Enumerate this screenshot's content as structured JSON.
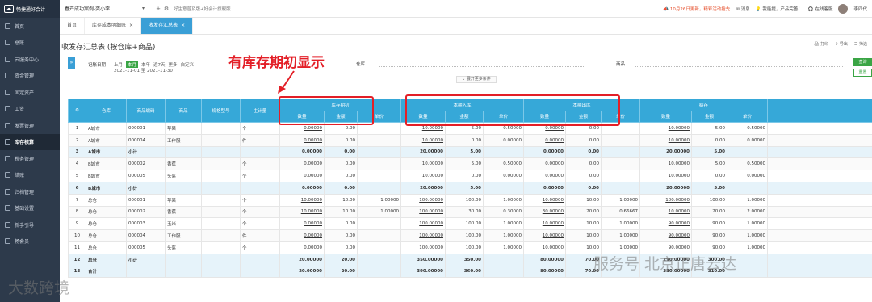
{
  "app": {
    "name": "畅捷通好会计",
    "company": "春卉成功案例-龚小李",
    "promo": "好生意普及版+好会计旗舰版"
  },
  "topbar": {
    "notice_date": "10月26日更新",
    "notice_text": "，精彩活动抢先",
    "msg_label": "消息",
    "feedback_label": "我能提，产品完善！",
    "service_label": "在线客服",
    "user_label": "李四代"
  },
  "sidebar": {
    "items": [
      {
        "label": "首页"
      },
      {
        "label": "总账"
      },
      {
        "label": "云服务中心"
      },
      {
        "label": "资金管理"
      },
      {
        "label": "固定资产"
      },
      {
        "label": "工资"
      },
      {
        "label": "发票管理"
      },
      {
        "label": "库存核算"
      },
      {
        "label": "税务管理"
      },
      {
        "label": "结账"
      },
      {
        "label": "归档管理"
      },
      {
        "label": "基础设置"
      },
      {
        "label": "新手引导"
      },
      {
        "label": "畅会员"
      }
    ],
    "active_index": 7
  },
  "tabs": [
    {
      "label": "首页"
    },
    {
      "label": "库存成本明细账"
    },
    {
      "label": "收发存汇总表"
    }
  ],
  "page": {
    "title": "收发存汇总表 (按仓库+商品)",
    "print": "打印",
    "export": "导出",
    "filter": "筛选"
  },
  "filters": {
    "date_label": "记账日期",
    "date_options": [
      "上月",
      "本月",
      "本年",
      "近7天",
      "更多",
      "自定义"
    ],
    "date_selected": "本月",
    "date_range": "2021-11-01 至 2021-11-30",
    "warehouse_label": "仓库",
    "goods_label": "商品",
    "query": "查询",
    "reset": "重置",
    "more": "展开更多条件"
  },
  "annotation": "有库存期初显示",
  "table": {
    "headers": [
      "仓库",
      "商品编码",
      "商品",
      "规格型号",
      "主计量"
    ],
    "groups": [
      "库存期初",
      "本期入库",
      "本期出库",
      "结存"
    ],
    "sub": [
      "数量",
      "金额",
      "单价"
    ],
    "rows": [
      [
        "1",
        "A城市",
        "000001",
        "苹果",
        "",
        "个",
        "0.00000",
        "0.00",
        "",
        "10.00000",
        "5.00",
        "0.50000",
        "0.00000",
        "0.00",
        "",
        "10.00000",
        "5.00",
        "0.50000"
      ],
      [
        "2",
        "A城市",
        "000004",
        "工作服",
        "",
        "件",
        "0.00000",
        "0.00",
        "",
        "10.00000",
        "0.00",
        "0.00000",
        "0.00000",
        "0.00",
        "",
        "10.00000",
        "0.00",
        "0.00000"
      ],
      [
        "3",
        "A城市",
        "小计",
        "",
        "",
        "",
        "0.00000",
        "0.00",
        "",
        "20.00000",
        "5.00",
        "",
        "0.00000",
        "0.00",
        "",
        "20.00000",
        "5.00",
        ""
      ],
      [
        "4",
        "B城市",
        "000002",
        "香蕉",
        "",
        "个",
        "0.00000",
        "0.00",
        "",
        "10.00000",
        "5.00",
        "0.50000",
        "0.00000",
        "0.00",
        "",
        "10.00000",
        "5.00",
        "0.50000"
      ],
      [
        "5",
        "B城市",
        "000005",
        "头盔",
        "",
        "个",
        "0.00000",
        "0.00",
        "",
        "10.00000",
        "0.00",
        "0.00000",
        "0.00000",
        "0.00",
        "",
        "10.00000",
        "0.00",
        "0.00000"
      ],
      [
        "6",
        "B城市",
        "小计",
        "",
        "",
        "",
        "0.00000",
        "0.00",
        "",
        "20.00000",
        "5.00",
        "",
        "0.00000",
        "0.00",
        "",
        "20.00000",
        "5.00",
        ""
      ],
      [
        "7",
        "总仓",
        "000001",
        "苹果",
        "",
        "个",
        "10.00000",
        "10.00",
        "1.00000",
        "100.00000",
        "100.00",
        "1.00000",
        "10.00000",
        "10.00",
        "1.00000",
        "100.00000",
        "100.00",
        "1.00000"
      ],
      [
        "8",
        "总仓",
        "000002",
        "香蕉",
        "",
        "个",
        "10.00000",
        "10.00",
        "1.00000",
        "100.00000",
        "30.00",
        "0.30000",
        "30.00000",
        "20.00",
        "0.66667",
        "10.00000",
        "20.00",
        "2.00000"
      ],
      [
        "9",
        "总仓",
        "000003",
        "玉米",
        "",
        "个",
        "0.00000",
        "0.00",
        "",
        "100.00000",
        "100.00",
        "1.00000",
        "10.00000",
        "10.00",
        "1.00000",
        "90.00000",
        "90.00",
        "1.00000"
      ],
      [
        "10",
        "总仓",
        "000004",
        "工作服",
        "",
        "件",
        "0.00000",
        "0.00",
        "",
        "100.00000",
        "100.00",
        "1.00000",
        "10.00000",
        "10.00",
        "1.00000",
        "90.00000",
        "90.00",
        "1.00000"
      ],
      [
        "11",
        "总仓",
        "000005",
        "头盔",
        "",
        "个",
        "0.00000",
        "0.00",
        "",
        "100.00000",
        "100.00",
        "1.00000",
        "10.00000",
        "10.00",
        "1.00000",
        "90.00000",
        "90.00",
        "1.00000"
      ],
      [
        "12",
        "总仓",
        "小计",
        "",
        "",
        "",
        "20.00000",
        "20.00",
        "",
        "350.00000",
        "350.00",
        "",
        "80.00000",
        "70.00",
        "",
        "290.00000",
        "300.00",
        ""
      ],
      [
        "13",
        "合计",
        "",
        "",
        "",
        "",
        "20.00000",
        "20.00",
        "",
        "390.00000",
        "360.00",
        "",
        "80.00000",
        "70.00",
        "",
        "330.00000",
        "310.00",
        ""
      ]
    ]
  },
  "watermarks": {
    "left": "大数跨境",
    "right": "服务号 北京正唐云达"
  }
}
